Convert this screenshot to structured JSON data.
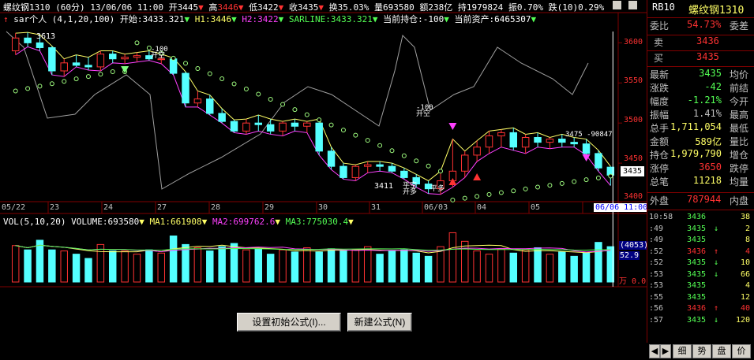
{
  "header": {
    "symbol": "螺纹钢1310",
    "period": "(60分)",
    "datetime": "13/06/06 11:00",
    "open_label": "开",
    "open_val": "3445",
    "high_label": "高",
    "high_val": "3446",
    "low_label": "低",
    "low_val": "3422",
    "close_label": "收",
    "close_val": "3435",
    "turnover_label": "换",
    "turnover_val": "35.03%",
    "volume_label": "量",
    "volume_val": "693580",
    "amount_label": "额",
    "amount_val": "238亿",
    "oi_label": "持",
    "oi_val": "1979824",
    "amplitude_label": "振",
    "amplitude_val": "0.70%",
    "change_label": "跌",
    "change_val": "(10)",
    "change_pct": "0.29%"
  },
  "indicator": {
    "name": "sar个人 (4,1,20,100)",
    "start_label": "开始:",
    "start_val": "3433.321",
    "h1": "H1:3446",
    "h2": "H2:3422",
    "sarline": "SARLINE:3433.321",
    "position": "当前持仓:-100",
    "assets": "当前资产:6465307"
  },
  "price_axis": [
    "3600",
    "3550",
    "3500",
    "3450",
    "3400"
  ],
  "last_price_tag": "3435",
  "price_annotations": {
    "high_mark": "3613",
    "low_mark": "3411",
    "sig1": "-100",
    "sig1b": "开空",
    "sig2": "-100",
    "sig2b": "开空",
    "sig3": "平空",
    "sig3b": "开多",
    "sig4": "平多",
    "right_label": "3475 -90847"
  },
  "date_axis": [
    "05/22",
    "23",
    "24",
    "27",
    "28",
    "29",
    "30",
    "31",
    "06/03",
    "04",
    "05",
    "06/06 11:00"
  ],
  "volume": {
    "title": "VOL(5,10,20)",
    "volume": "VOLUME:693580",
    "ma1": "MA1:661908",
    "ma2": "MA2:699762.6",
    "ma3": "MA3:775030.4",
    "axis_top": "(4053)",
    "axis_mid": "52.9",
    "axis_unit": "万",
    "axis_zero": "0.0"
  },
  "chart_data": {
    "type": "candlestick",
    "ylim": [
      3400,
      3620
    ],
    "candles": [
      [
        3590,
        3612,
        3585,
        3606
      ],
      [
        3606,
        3613,
        3595,
        3600
      ],
      [
        3600,
        3610,
        3590,
        3594
      ],
      [
        3594,
        3596,
        3560,
        3565
      ],
      [
        3565,
        3580,
        3558,
        3575
      ],
      [
        3575,
        3585,
        3570,
        3572
      ],
      [
        3572,
        3582,
        3566,
        3570
      ],
      [
        3570,
        3590,
        3565,
        3586
      ],
      [
        3586,
        3590,
        3575,
        3580
      ],
      [
        3580,
        3586,
        3574,
        3582
      ],
      [
        3582,
        3588,
        3576,
        3584
      ],
      [
        3584,
        3590,
        3578,
        3580
      ],
      [
        3580,
        3586,
        3574,
        3580
      ],
      [
        3580,
        3581,
        3560,
        3562
      ],
      [
        3562,
        3564,
        3520,
        3525
      ],
      [
        3525,
        3540,
        3520,
        3530
      ],
      [
        3530,
        3535,
        3510,
        3512
      ],
      [
        3512,
        3518,
        3500,
        3502
      ],
      [
        3502,
        3504,
        3488,
        3490
      ],
      [
        3490,
        3505,
        3486,
        3500
      ],
      [
        3500,
        3510,
        3490,
        3498
      ],
      [
        3498,
        3505,
        3486,
        3490
      ],
      [
        3490,
        3502,
        3484,
        3500
      ],
      [
        3500,
        3505,
        3490,
        3496
      ],
      [
        3496,
        3502,
        3488,
        3500
      ],
      [
        3500,
        3505,
        3460,
        3465
      ],
      [
        3465,
        3470,
        3442,
        3446
      ],
      [
        3446,
        3450,
        3430,
        3432
      ],
      [
        3432,
        3448,
        3428,
        3446
      ],
      [
        3446,
        3452,
        3438,
        3448
      ],
      [
        3448,
        3452,
        3440,
        3446
      ],
      [
        3446,
        3450,
        3438,
        3440
      ],
      [
        3440,
        3444,
        3430,
        3432
      ],
      [
        3432,
        3436,
        3420,
        3424
      ],
      [
        3424,
        3428,
        3412,
        3418
      ],
      [
        3418,
        3440,
        3411,
        3428
      ],
      [
        3428,
        3480,
        3420,
        3440
      ],
      [
        3440,
        3465,
        3432,
        3460
      ],
      [
        3460,
        3478,
        3452,
        3470
      ],
      [
        3470,
        3490,
        3462,
        3484
      ],
      [
        3484,
        3492,
        3470,
        3488
      ],
      [
        3488,
        3494,
        3466,
        3470
      ],
      [
        3470,
        3486,
        3462,
        3482
      ],
      [
        3482,
        3488,
        3470,
        3476
      ],
      [
        3476,
        3482,
        3468,
        3480
      ],
      [
        3480,
        3486,
        3470,
        3476
      ],
      [
        3476,
        3482,
        3470,
        3474
      ],
      [
        3474,
        3480,
        3460,
        3462
      ],
      [
        3462,
        3466,
        3440,
        3444
      ],
      [
        3445,
        3446,
        3422,
        3435
      ]
    ],
    "volumes": [
      68,
      60,
      78,
      60,
      58,
      52,
      44,
      70,
      58,
      58,
      52,
      60,
      54,
      86,
      70,
      64,
      58,
      66,
      72,
      60,
      62,
      52,
      60,
      56,
      64,
      56,
      62,
      58,
      60,
      66,
      52,
      58,
      60,
      54,
      48,
      66,
      92,
      76,
      58,
      52,
      62,
      54,
      60,
      64,
      52,
      56,
      48,
      54,
      74,
      66
    ]
  },
  "right_panel": {
    "code": "RB10",
    "name": "螺纹钢1310",
    "weibi_label": "委比",
    "weibi_val": "54.73%",
    "weicha_label": "委差",
    "sell_label": "卖",
    "sell_val": "3436",
    "buy_label": "买",
    "buy_val": "3435",
    "rows": [
      [
        "最新",
        "3435",
        "均价"
      ],
      [
        "涨跌",
        "-42",
        "前结"
      ],
      [
        "幅度",
        "-1.21%",
        "今开"
      ],
      [
        "振幅",
        "1.41%",
        "最高"
      ],
      [
        "总手",
        "1,711,054",
        "最低"
      ],
      [
        "金额",
        "589亿",
        "量比"
      ],
      [
        "持仓",
        "1,979,790",
        "增仓"
      ],
      [
        "涨停",
        "3650",
        "跌停"
      ],
      [
        "总笔",
        "11218",
        "均量"
      ]
    ],
    "outer_label": "外盘",
    "outer_val": "787944",
    "inner_label": "内盘",
    "ticks": [
      [
        "10:58",
        "3436",
        "",
        "38"
      ],
      [
        ":49",
        "3435",
        "↓",
        "2"
      ],
      [
        ":49",
        "3435",
        "",
        "8"
      ],
      [
        ":52",
        "3436",
        "↑",
        "4"
      ],
      [
        ":52",
        "3435",
        "↓",
        "10"
      ],
      [
        ":53",
        "3435",
        "↓",
        "66"
      ],
      [
        ":53",
        "3435",
        "",
        "4"
      ],
      [
        ":55",
        "3435",
        "",
        "12"
      ],
      [
        ":56",
        "3436",
        "↑",
        "40"
      ],
      [
        ":57",
        "3435",
        "↓",
        "120"
      ]
    ],
    "tabs": [
      "◀",
      "▶",
      "细",
      "势",
      "盘",
      "价"
    ]
  },
  "buttons": {
    "init_formula": "设置初始公式(I)...",
    "new_formula": "新建公式(N)"
  },
  "colors": {
    "up": "#ff3232",
    "down": "#54ffff",
    "sar": "#ffff66",
    "magenta": "#ff40ff",
    "grid": "#800000"
  }
}
